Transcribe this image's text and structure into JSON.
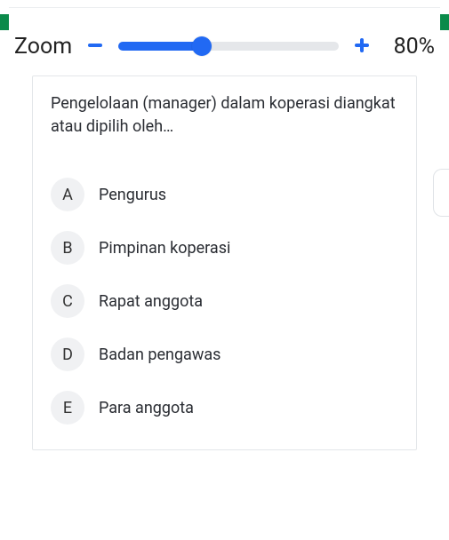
{
  "zoom": {
    "label": "Zoom",
    "percent": "80%"
  },
  "question": {
    "text": "Pengelolaan (manager) dalam koperasi diangkat atau dipilih oleh…",
    "options": [
      {
        "letter": "A",
        "label": "Pengurus"
      },
      {
        "letter": "B",
        "label": "Pimpinan koperasi"
      },
      {
        "letter": "C",
        "label": "Rapat anggota"
      },
      {
        "letter": "D",
        "label": "Badan pengawas"
      },
      {
        "letter": "E",
        "label": "Para anggota"
      }
    ]
  }
}
